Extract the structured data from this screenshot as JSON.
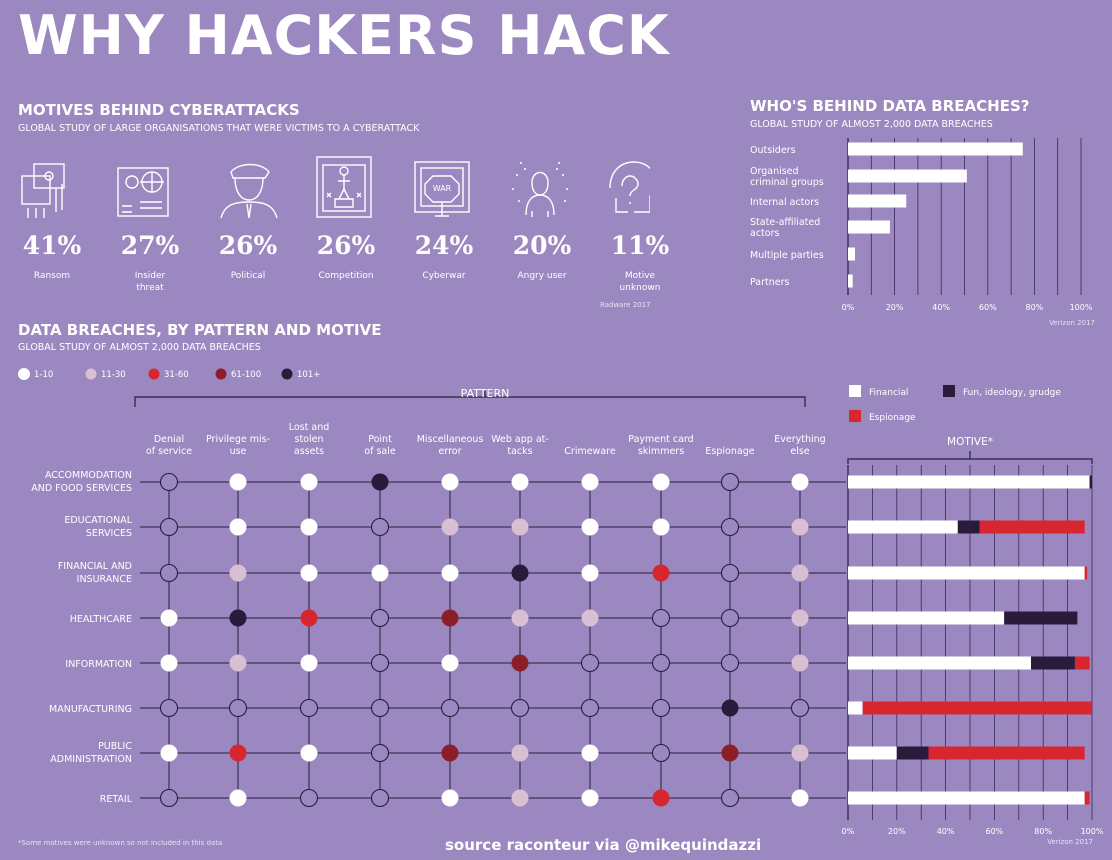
{
  "title": "WHY HACKERS HACK",
  "motives": {
    "heading": "MOTIVES BEHIND CYBERATTACKS",
    "subheading": "GLOBAL STUDY OF LARGE ORGANISATIONS THAT WERE VICTIMS TO A CYBERATTACK",
    "source": "Radware 2017",
    "items": [
      {
        "pct": "41%",
        "label": "Ransom",
        "icon": "ransom-icon"
      },
      {
        "pct": "27%",
        "label": "Insider threat",
        "icon": "insider-icon"
      },
      {
        "pct": "26%",
        "label": "Political",
        "icon": "political-icon"
      },
      {
        "pct": "26%",
        "label": "Competition",
        "icon": "competition-icon"
      },
      {
        "pct": "24%",
        "label": "Cyberwar",
        "icon": "cyberwar-icon"
      },
      {
        "pct": "20%",
        "label": "Angry user",
        "icon": "angry-user-icon"
      },
      {
        "pct": "11%",
        "label": "Motive unknown",
        "icon": "motive-unknown-icon"
      }
    ]
  },
  "who": {
    "heading": "WHO'S BEHIND DATA BREACHES?",
    "subheading": "GLOBAL STUDY OF ALMOST 2,000 DATA BREACHES",
    "source": "Verizon 2017"
  },
  "breaches": {
    "heading": "DATA BREACHES, BY PATTERN AND MOTIVE",
    "subheading": "GLOBAL STUDY OF ALMOST 2,000 DATA BREACHES",
    "pattern_label": "PATTERN",
    "motive_label": "MOTIVE*",
    "source": "Verizon 2017",
    "footnote": "*Some motives were unknown so not included in this data"
  },
  "credit": "source raconteur via @mikequindazzi",
  "colors": {
    "background": "#9b88c0",
    "white": "#ffffff",
    "dark": "#2a1b3d",
    "red": "#d8262e",
    "pink": "#d8bfd2",
    "darkred": "#8c1e2a"
  },
  "chart_data": [
    {
      "type": "bar",
      "orientation": "horizontal",
      "categories": [
        "Outsiders",
        "Organised criminal groups",
        "Internal actors",
        "State-affiliated actors",
        "Multiple parties",
        "Partners"
      ],
      "values": [
        75,
        51,
        25,
        18,
        3,
        2
      ],
      "xlim": [
        0,
        100
      ],
      "xticks": [
        "0%",
        "20%",
        "40%",
        "60%",
        "80%",
        "100%"
      ],
      "grid": true
    },
    {
      "type": "scatter",
      "legend_title": "",
      "size_legend": [
        "1-10",
        "11-30",
        "31-60",
        "61-100",
        "101+"
      ],
      "patterns": [
        "Denial of service",
        "Privilege mis-use",
        "Lost and stolen assets",
        "Point of sale",
        "Miscellaneous error",
        "Web app at-tacks",
        "Crimeware",
        "Payment card skimmers",
        "Espionage",
        "Everything else"
      ],
      "industries": [
        "ACCOMMODATION AND FOOD SERVICES",
        "EDUCATIONAL SERVICES",
        "FINANCIAL AND INSURANCE",
        "HEALTHCARE",
        "INFORMATION",
        "MANUFACTURING",
        "PUBLIC ADMINISTRATION",
        "RETAIL"
      ],
      "matrix": [
        [
          0,
          1,
          1,
          4,
          1,
          1,
          1,
          1,
          0,
          1
        ],
        [
          0,
          1,
          1,
          0,
          2,
          2,
          1,
          1,
          0,
          2
        ],
        [
          0,
          2,
          1,
          1,
          1,
          4,
          1,
          3,
          0,
          2
        ],
        [
          1,
          4,
          3,
          0,
          5,
          2,
          2,
          0,
          0,
          2
        ],
        [
          1,
          2,
          1,
          0,
          1,
          5,
          0,
          0,
          0,
          2
        ],
        [
          0,
          0,
          0,
          0,
          0,
          0,
          0,
          0,
          4,
          0
        ],
        [
          1,
          3,
          1,
          0,
          5,
          2,
          1,
          0,
          5,
          2
        ],
        [
          0,
          1,
          0,
          0,
          1,
          2,
          1,
          3,
          0,
          1
        ]
      ],
      "matrix_code": {
        "0": "none",
        "1": "1-10",
        "2": "11-30",
        "3": "31-60",
        "4": "101+",
        "5": "61-100"
      }
    },
    {
      "type": "bar",
      "orientation": "horizontal",
      "stacked": true,
      "categories": [
        "ACCOMMODATION AND FOOD SERVICES",
        "EDUCATIONAL SERVICES",
        "FINANCIAL AND INSURANCE",
        "HEALTHCARE",
        "INFORMATION",
        "MANUFACTURING",
        "PUBLIC ADMINISTRATION",
        "RETAIL"
      ],
      "series": [
        {
          "name": "Financial",
          "values": [
            99,
            45,
            97,
            64,
            75,
            6,
            20,
            97
          ]
        },
        {
          "name": "Fun, ideology, grudge",
          "values": [
            1,
            9,
            0,
            30,
            18,
            0,
            13,
            0
          ]
        },
        {
          "name": "Espionage",
          "values": [
            0,
            43,
            1,
            0,
            6,
            94,
            64,
            2
          ]
        }
      ],
      "xlim": [
        0,
        100
      ],
      "xticks": [
        "0%",
        "20%",
        "40%",
        "60%",
        "80%",
        "100%"
      ]
    }
  ]
}
